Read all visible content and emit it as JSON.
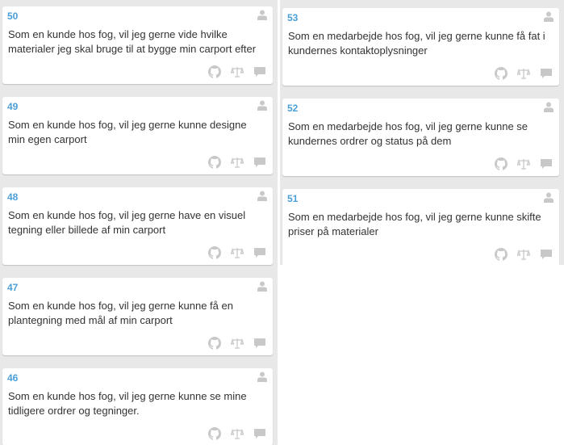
{
  "left_column": {
    "cards": [
      {
        "number": "50",
        "text": "Som en kunde hos fog, vil jeg gerne vide hvilke materialer jeg skal bruge til at bygge min carport efter"
      },
      {
        "number": "49",
        "text": "Som en kunde hos fog, vil jeg gerne kunne designe min egen carport"
      },
      {
        "number": "48",
        "text": "Som en kunde hos fog, vil jeg gerne have en visuel tegning eller billede af min carport"
      },
      {
        "number": "47",
        "text": "Som en kunde hos fog, vil jeg gerne kunne få en plantegning med mål af min carport"
      },
      {
        "number": "46",
        "text": "Som en kunde hos fog, vil jeg gerne kunne se mine tidligere ordrer og tegninger."
      }
    ]
  },
  "right_column": {
    "cards": [
      {
        "number": "53",
        "text": "Som en medarbejde hos fog, vil jeg gerne kunne få fat i kundernes kontaktoplysninger"
      },
      {
        "number": "52",
        "text": "Som en medarbejde hos fog, vil jeg gerne kunne se kundernes ordrer og status på dem"
      },
      {
        "number": "51",
        "text": "Som en medarbejde hos fog, vil jeg gerne kunne skifte priser på materialer"
      }
    ]
  },
  "icons": {
    "assignee": "user-icon",
    "actions": [
      "github-icon",
      "scale-icon",
      "comment-icon"
    ]
  },
  "colors": {
    "board_background": "#e8e8e8",
    "card_background": "#ffffff",
    "card_number": "#4a9fd9",
    "card_text": "#333333",
    "icon": "#c8c8c8"
  }
}
